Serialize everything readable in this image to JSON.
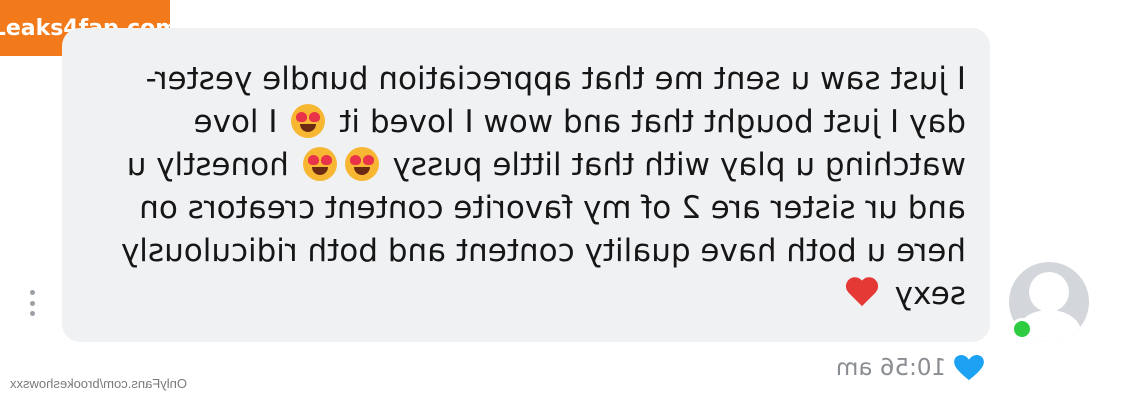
{
  "watermark": {
    "text": "Leaks4fap.com"
  },
  "message": {
    "lines": [
      "I just saw u sent me that appreciation bundle yester-",
      "day I just bought that and wow I loved it",
      "I love",
      "watching u play with that little pussy",
      "honestly u",
      "and ur sister are 2 of my favorite content creators on",
      "here u both have quality content and both ridiculously",
      "sexy"
    ],
    "time": "10:56 am"
  },
  "credit": {
    "text": "OnlyFans.com/brookeshowsxx"
  },
  "icons": {
    "more": "more-vertical-icon",
    "avatar": "user-avatar-icon",
    "status": "online-status-icon",
    "like": "heart-like-icon",
    "emoji_love": "heart-eyes-emoji-icon",
    "emoji_heart": "red-heart-emoji-icon"
  },
  "colors": {
    "bubble": "#f0f1f3",
    "like": "#1da1f2",
    "online": "#2ecc40",
    "watermark": "#f27a1a"
  }
}
